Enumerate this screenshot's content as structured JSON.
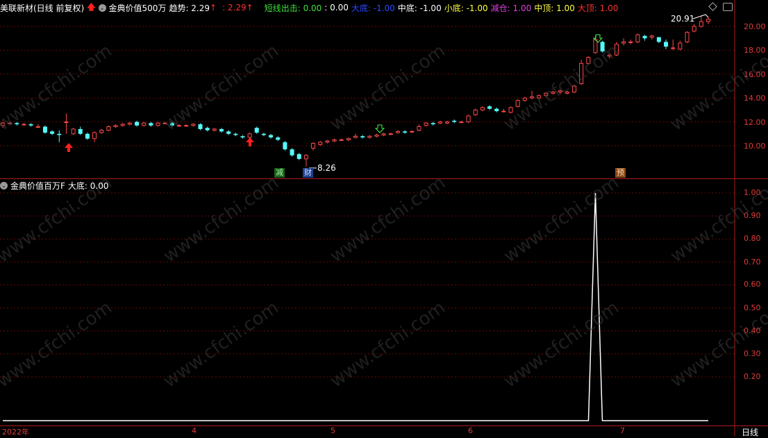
{
  "header_top": {
    "stock": "美联新材(日线 前复权)",
    "indicator": "金典价值500万",
    "trend_label": "趋势: 2.29",
    "trend_arrow": "↑",
    "trend_value2": ": 2.29",
    "trend_arrow2": "↑",
    "short_exit": "短线出击: 0.00",
    "v000": ": 0.00",
    "big_bottom": "大底: -1.00",
    "mid_bottom": "中底: -1.00",
    "small_bottom": "小底: -1.00",
    "reduce": "减仓: 1.00",
    "mid_top": "中顶: 1.00",
    "big_top": "大顶: 1.00"
  },
  "header_bottom": {
    "indicator": "金典价值百万F",
    "big_bottom": "大底: 0.00"
  },
  "price_axis": [
    "20.00",
    "18.00",
    "16.00",
    "14.00",
    "12.00",
    "10.00"
  ],
  "sub_axis": [
    "1.00",
    "0.90",
    "0.80",
    "0.70",
    "0.60",
    "0.50",
    "0.40",
    "0.30",
    "0.20"
  ],
  "x_axis": {
    "year": "2022年",
    "m4": "4",
    "m5": "5",
    "m6": "6",
    "m7": "7",
    "period": "日线"
  },
  "annotations": {
    "high_price": "20.91",
    "low_price": "8.26",
    "tag_reduce": "减",
    "tag_wealth": "财",
    "tag_pre": "预"
  },
  "colors": {
    "up": "#ff4a4a",
    "down": "#54fcfc",
    "grid": "#6a0a0a",
    "axis_text": "#e23a3a"
  },
  "chart_data": {
    "type": "candlestick",
    "ylim": [
      7.5,
      21.5
    ],
    "candles": [
      [
        11.7,
        11.9,
        11.5,
        12.0
      ],
      [
        11.9,
        11.9,
        11.8,
        12.0
      ],
      [
        11.9,
        11.8,
        11.7,
        12.0
      ],
      [
        11.8,
        11.8,
        11.7,
        11.9
      ],
      [
        11.8,
        11.7,
        11.6,
        11.9
      ],
      [
        11.6,
        11.6,
        11.5,
        11.8
      ],
      [
        11.6,
        11.1,
        11.0,
        11.7
      ],
      [
        11.2,
        11.0,
        10.9,
        11.3
      ],
      [
        11.0,
        10.9,
        10.3,
        11.3
      ],
      [
        12.0,
        12.0,
        11.0,
        12.7
      ],
      [
        11.0,
        11.4,
        10.9,
        11.5
      ],
      [
        11.4,
        11.0,
        10.9,
        11.6
      ],
      [
        11.0,
        10.6,
        10.5,
        11.1
      ],
      [
        10.6,
        11.1,
        10.3,
        11.2
      ],
      [
        11.1,
        11.3,
        11.0,
        11.4
      ],
      [
        11.3,
        11.6,
        11.2,
        11.7
      ],
      [
        11.6,
        11.7,
        11.5,
        11.8
      ],
      [
        11.7,
        11.8,
        11.6,
        11.9
      ],
      [
        11.8,
        11.9,
        11.7,
        12.0
      ],
      [
        12.0,
        11.7,
        11.6,
        12.1
      ],
      [
        11.7,
        11.9,
        11.6,
        12.0
      ],
      [
        11.9,
        11.7,
        11.6,
        12.0
      ],
      [
        11.7,
        11.9,
        11.6,
        12.0
      ],
      [
        11.9,
        11.9,
        11.8,
        12.0
      ],
      [
        11.9,
        11.7,
        11.6,
        12.0
      ],
      [
        11.7,
        11.7,
        11.6,
        11.8
      ],
      [
        11.7,
        11.7,
        11.6,
        11.8
      ],
      [
        11.7,
        11.8,
        11.6,
        11.9
      ],
      [
        11.8,
        11.4,
        11.3,
        11.9
      ],
      [
        11.5,
        11.3,
        11.2,
        11.6
      ],
      [
        11.3,
        11.4,
        11.2,
        11.5
      ],
      [
        11.4,
        11.2,
        11.1,
        11.5
      ],
      [
        11.2,
        11.0,
        10.9,
        11.3
      ],
      [
        11.0,
        10.9,
        10.8,
        11.1
      ],
      [
        10.8,
        10.7,
        10.6,
        10.9
      ],
      [
        10.7,
        11.0,
        10.6,
        11.1
      ],
      [
        11.5,
        11.1,
        11.0,
        11.6
      ],
      [
        11.0,
        10.9,
        10.8,
        11.1
      ],
      [
        10.9,
        10.7,
        10.6,
        11.0
      ],
      [
        10.7,
        10.5,
        10.4,
        10.8
      ],
      [
        10.3,
        9.7,
        9.6,
        10.4
      ],
      [
        9.7,
        9.2,
        9.1,
        9.8
      ],
      [
        9.3,
        8.9,
        8.8,
        9.4
      ],
      [
        8.9,
        9.2,
        8.26,
        9.3
      ],
      [
        9.8,
        10.2,
        9.6,
        10.3
      ],
      [
        10.1,
        10.3,
        10.0,
        10.4
      ],
      [
        10.3,
        10.4,
        10.2,
        10.5
      ],
      [
        10.4,
        10.5,
        10.3,
        10.6
      ],
      [
        10.5,
        10.5,
        10.4,
        10.6
      ],
      [
        10.5,
        10.6,
        10.4,
        10.7
      ],
      [
        10.7,
        10.8,
        10.6,
        11.0
      ],
      [
        10.8,
        10.7,
        10.6,
        10.9
      ],
      [
        10.7,
        10.8,
        10.6,
        10.9
      ],
      [
        10.8,
        10.9,
        10.7,
        11.0
      ],
      [
        10.9,
        11.0,
        10.8,
        11.1
      ],
      [
        11.0,
        11.0,
        10.9,
        11.1
      ],
      [
        11.1,
        11.2,
        11.0,
        11.3
      ],
      [
        11.2,
        11.1,
        11.0,
        11.3
      ],
      [
        11.2,
        11.2,
        11.1,
        11.3
      ],
      [
        11.3,
        11.6,
        11.2,
        11.8
      ],
      [
        11.7,
        11.9,
        11.6,
        12.0
      ],
      [
        11.9,
        11.8,
        11.7,
        12.0
      ],
      [
        11.9,
        12.0,
        11.8,
        12.1
      ],
      [
        11.9,
        12.0,
        11.8,
        12.1
      ],
      [
        12.1,
        12.0,
        11.9,
        12.2
      ],
      [
        12.0,
        12.0,
        11.9,
        12.1
      ],
      [
        12.0,
        12.5,
        11.9,
        12.6
      ],
      [
        12.6,
        13.0,
        12.5,
        13.1
      ],
      [
        13.0,
        13.2,
        12.9,
        13.3
      ],
      [
        13.3,
        13.1,
        13.0,
        13.4
      ],
      [
        13.1,
        12.9,
        12.8,
        13.2
      ],
      [
        12.9,
        12.9,
        12.8,
        13.1
      ],
      [
        12.8,
        13.2,
        12.7,
        13.3
      ],
      [
        13.3,
        13.8,
        13.2,
        13.9
      ],
      [
        13.8,
        14.0,
        13.7,
        14.1
      ],
      [
        14.0,
        14.1,
        13.9,
        14.6
      ],
      [
        14.0,
        14.2,
        13.9,
        14.3
      ],
      [
        14.2,
        14.4,
        14.1,
        14.5
      ],
      [
        14.4,
        14.5,
        14.3,
        14.6
      ],
      [
        14.5,
        14.6,
        14.3,
        14.7
      ],
      [
        14.4,
        14.5,
        14.3,
        14.6
      ],
      [
        14.5,
        15.0,
        14.4,
        15.1
      ],
      [
        15.2,
        16.9,
        15.1,
        17.2
      ],
      [
        16.9,
        17.4,
        16.8,
        17.5
      ],
      [
        17.8,
        18.9,
        17.7,
        19.2
      ],
      [
        18.7,
        17.9,
        17.8,
        18.8
      ],
      [
        17.5,
        17.6,
        17.3,
        17.7
      ],
      [
        17.6,
        18.5,
        17.5,
        18.7
      ],
      [
        18.6,
        18.7,
        18.4,
        19.0
      ],
      [
        18.7,
        18.7,
        18.5,
        18.9
      ],
      [
        18.7,
        19.3,
        18.6,
        19.4
      ],
      [
        19.2,
        19.0,
        18.8,
        19.3
      ],
      [
        19.1,
        19.2,
        18.9,
        19.3
      ],
      [
        19.1,
        18.7,
        18.6,
        19.1
      ],
      [
        18.7,
        18.3,
        18.1,
        18.9
      ],
      [
        18.2,
        18.2,
        18.0,
        18.9
      ],
      [
        18.1,
        18.6,
        18.0,
        18.8
      ],
      [
        18.7,
        19.5,
        18.6,
        19.6
      ],
      [
        19.6,
        20.0,
        19.5,
        20.2
      ],
      [
        20.0,
        20.4,
        19.9,
        20.91
      ],
      [
        20.4,
        20.6,
        20.2,
        20.8
      ]
    ],
    "sub_series": {
      "name": "大底",
      "spike_index": 84,
      "spike_value": 1.0,
      "ylim": [
        0.05,
        1.05
      ]
    }
  }
}
